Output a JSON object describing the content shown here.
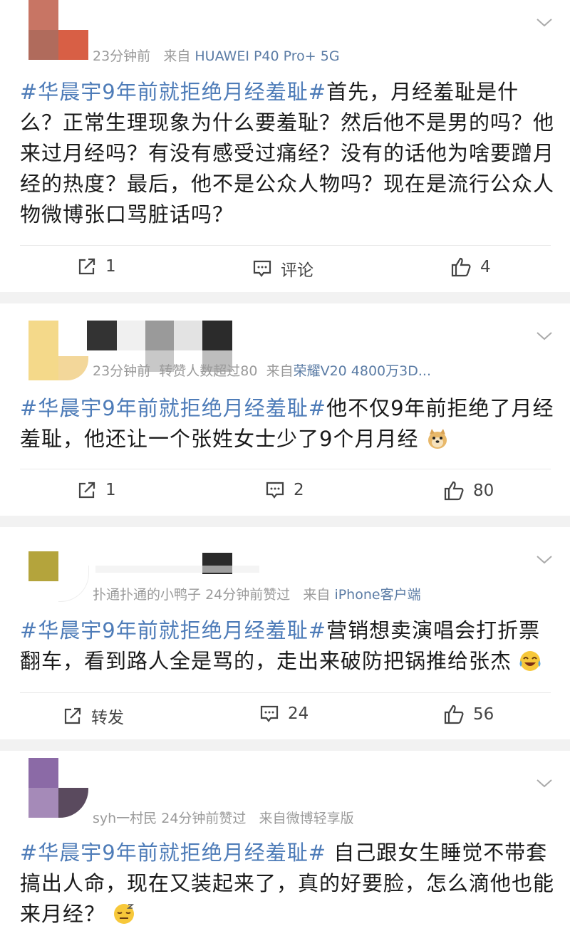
{
  "posts": [
    {
      "meta_time": "23分钟前",
      "meta_from_label": "来自",
      "meta_source": "HUAWEI P40 Pro+ 5G",
      "hashtag": "#华晨宇9年前就拒绝月经羞耻#",
      "text": "首先，月经羞耻是什么？正常生理现象为什么要羞耻？然后他不是男的吗？他来过月经吗？有没有感受过痛经？没有的话他为啥要蹭月经的热度？最后，他不是公众人物吗？现在是流行公众人物微博张口骂脏话吗？",
      "share": "1",
      "comment": "评论",
      "like": "4"
    },
    {
      "meta_time": "23分钟前",
      "meta_extra": "转赞人数超过80",
      "meta_from_label": "来自",
      "meta_source": "荣耀V20 4800万3D...",
      "hashtag": "#华晨宇9年前就拒绝月经羞耻#",
      "text": "他不仅9年前拒绝了月经羞耻，他还让一个张姓女士少了9个月月经",
      "share": "1",
      "comment": "2",
      "like": "80"
    },
    {
      "meta_user": "扑通扑通的小鸭子",
      "meta_time": "24分钟前赞过",
      "meta_from_label": "来自",
      "meta_source": "iPhone客户端",
      "hashtag": "#华晨宇9年前就拒绝月经羞耻#",
      "text": "营销想卖演唱会打折票翻车，看到路人全是骂的，走出来破防把锅推给张杰",
      "share": "转发",
      "comment": "24",
      "like": "56"
    },
    {
      "meta_user": "syh一村民",
      "meta_time": "24分钟前赞过",
      "meta_from_label": "来自",
      "meta_source": "微博轻享版",
      "hashtag": "#华晨宇9年前就拒绝月经羞耻#",
      "text": "自己跟女生睡觉不带套搞出人命，现在又装起来了，真的好要脸，怎么滴他也能来月经？"
    }
  ],
  "colors": {
    "hashtag": "#4e7cb8",
    "source": "#5b7ca5",
    "meta": "#9a9a9a"
  }
}
